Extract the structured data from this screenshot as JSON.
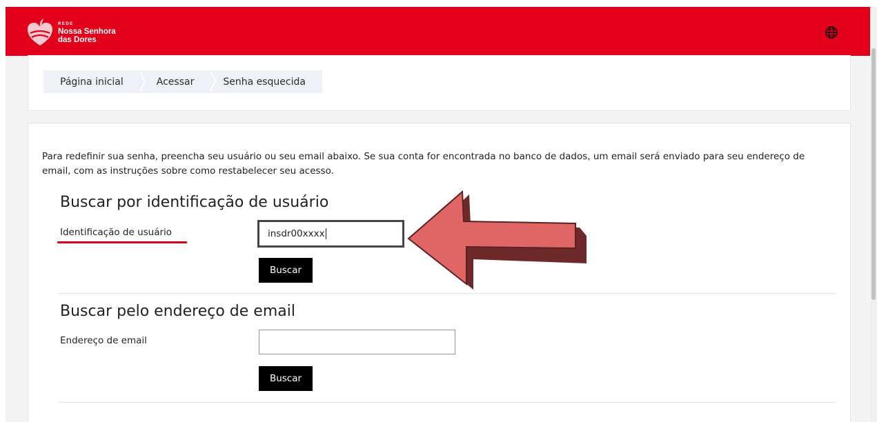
{
  "brand": {
    "small": "REDE",
    "line1": "Nossa Senhora",
    "line2": "das Dores"
  },
  "header": {
    "language_icon": "globe-icon",
    "color": "#e2001a"
  },
  "breadcrumb": [
    {
      "label": "Página inicial"
    },
    {
      "label": "Acessar"
    },
    {
      "label": "Senha esquecida"
    }
  ],
  "intro": "Para redefinir sua senha, preencha seu usuário ou seu email abaixo. Se sua conta for encontrada no banco de dados, um email será enviado para seu endereço de email, com as instruções sobre como restabelecer seu acesso.",
  "username_section": {
    "title": "Buscar por identificação de usuário",
    "label": "Identificação de usuário",
    "value": "insdr00xxxx",
    "button": "Buscar"
  },
  "email_section": {
    "title": "Buscar pelo endereço de email",
    "label": "Endereço de email",
    "value": "",
    "button": "Buscar"
  },
  "annotation": {
    "arrow_icon": "pointer-arrow-icon",
    "arrow_color": "#e06666",
    "underline_color": "#d6001c"
  }
}
